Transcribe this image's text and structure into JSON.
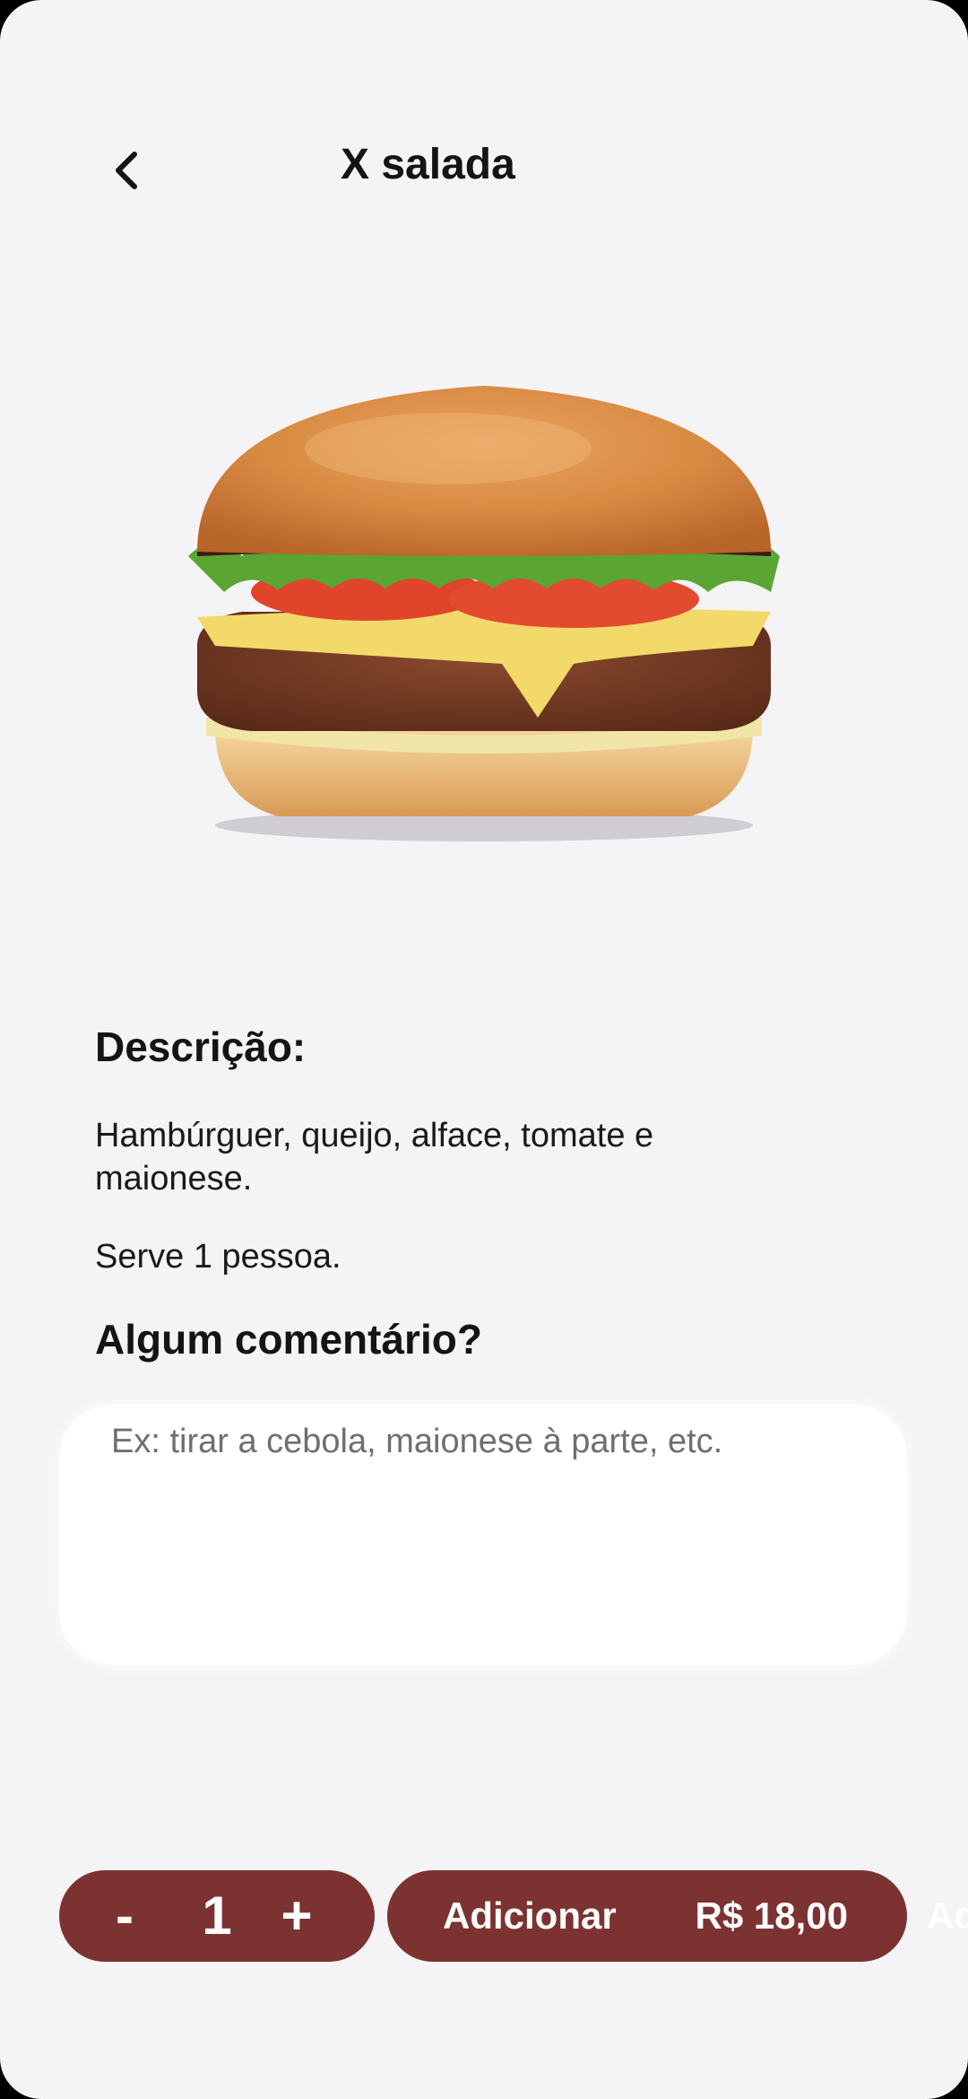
{
  "header": {
    "title": "X salada"
  },
  "icons": {
    "back": "chevron-left-icon"
  },
  "product": {
    "image": "burger-image"
  },
  "description": {
    "heading": "Descrição:",
    "text": "Hambúrguer, queijo, alface, tomate e maionese.",
    "serves": "Serve 1 pessoa."
  },
  "comment": {
    "heading": "Algum comentário?",
    "placeholder": "Ex: tirar a cebola, maionese à parte, etc.",
    "value": ""
  },
  "quantity": {
    "minus": "-",
    "value": "1",
    "plus": "+"
  },
  "add_button": {
    "label": "Adicionar",
    "price": "R$ 18,00"
  },
  "offscreen_label": "Ad",
  "colors": {
    "accent": "#7b3231",
    "background": "#f4f3f6",
    "input_bg": "#ffffff"
  }
}
